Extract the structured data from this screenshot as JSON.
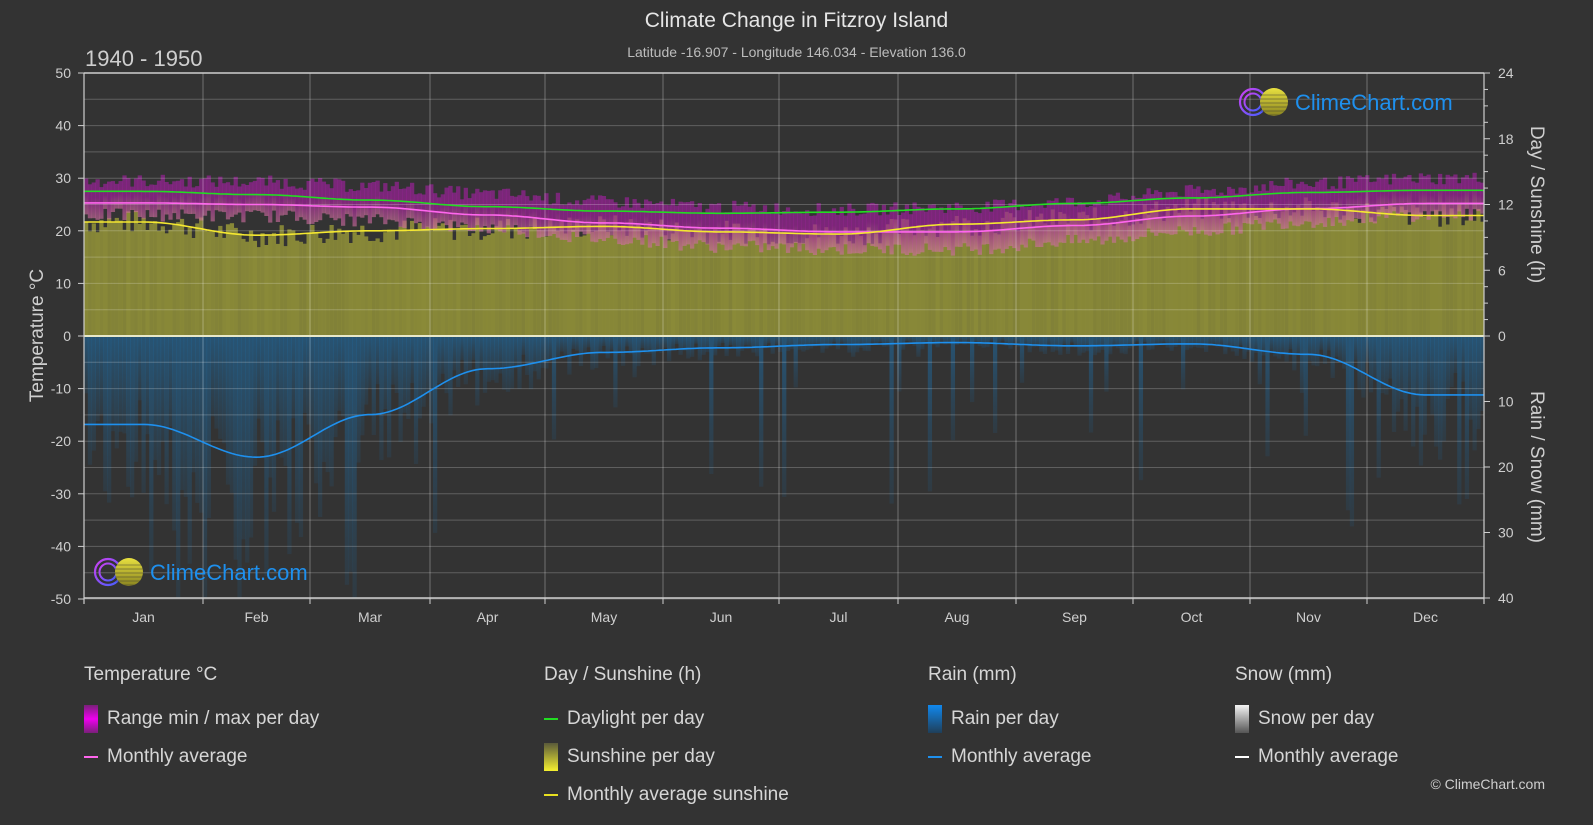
{
  "header": {
    "title": "Climate Change in Fitzroy Island",
    "subtitle": "Latitude -16.907 - Longitude 146.034 - Elevation 136.0",
    "year_range": "1940 - 1950"
  },
  "watermark": {
    "text": "ClimeChart.com"
  },
  "copyright": "© ClimeChart.com",
  "colors": {
    "background": "#333333",
    "temp_range": "#e000e0",
    "temp_avg": "#ff66ee",
    "daylight": "#22dd22",
    "sunshine_fill": "#8a8a38",
    "sunshine_avg": "#f5e830",
    "rain_fill": "#1f5e8c",
    "rain_avg": "#1e90ee",
    "snow_avg": "#ffffff",
    "brand_blue": "#1e90ee"
  },
  "chart_data": {
    "type": "area",
    "title": "Climate Change in Fitzroy Island",
    "subtitle": "Latitude -16.907 - Longitude 146.034 - Elevation 136.0",
    "period": "1940 - 1950",
    "categories": [
      "Jan",
      "Feb",
      "Mar",
      "Apr",
      "May",
      "Jun",
      "Jul",
      "Aug",
      "Sep",
      "Oct",
      "Nov",
      "Dec"
    ],
    "axes": {
      "left": {
        "label": "Temperature °C",
        "range": [
          -50,
          50
        ],
        "ticks": [
          50,
          40,
          30,
          20,
          10,
          0,
          -10,
          -20,
          -30,
          -40,
          -50
        ]
      },
      "right_top": {
        "label": "Day / Sunshine (h)",
        "range": [
          0,
          24
        ],
        "ticks": [
          24,
          18,
          12,
          6,
          0
        ]
      },
      "right_bottom": {
        "label": "Rain / Snow (mm)",
        "range": [
          0,
          40
        ],
        "ticks": [
          0,
          10,
          20,
          30,
          40
        ]
      }
    },
    "grid": true,
    "series": [
      {
        "name": "Daylight per day",
        "axis": "hours",
        "values": [
          13.2,
          12.9,
          12.4,
          11.8,
          11.4,
          11.2,
          11.3,
          11.6,
          12.1,
          12.6,
          13.1,
          13.3
        ]
      },
      {
        "name": "Monthly average sunshine",
        "axis": "hours",
        "values": [
          10.4,
          9.2,
          9.6,
          9.8,
          10.0,
          9.5,
          9.3,
          10.2,
          10.6,
          11.6,
          11.6,
          11.0
        ]
      },
      {
        "name": "Temperature monthly average",
        "axis": "temperature",
        "values": [
          25.3,
          25.0,
          24.5,
          23.0,
          21.5,
          20.5,
          19.8,
          19.8,
          21.0,
          22.8,
          24.2,
          25.2
        ]
      },
      {
        "name": "Temperature daily max (approx.)",
        "axis": "temperature",
        "values": [
          29.0,
          28.8,
          28.0,
          26.5,
          25.0,
          24.0,
          23.5,
          24.0,
          25.0,
          27.0,
          28.5,
          29.5
        ]
      },
      {
        "name": "Temperature daily min (approx.)",
        "axis": "temperature",
        "values": [
          23.0,
          22.8,
          22.0,
          20.5,
          18.5,
          17.0,
          16.5,
          16.5,
          18.0,
          20.0,
          21.8,
          23.0
        ]
      },
      {
        "name": "Rain monthly average",
        "axis": "rain_mm",
        "values": [
          13.5,
          18.5,
          12.0,
          5.0,
          2.5,
          1.8,
          1.3,
          1.0,
          1.5,
          1.2,
          2.8,
          9.0
        ]
      },
      {
        "name": "Snow monthly average",
        "axis": "rain_mm",
        "values": [
          0,
          0,
          0,
          0,
          0,
          0,
          0,
          0,
          0,
          0,
          0,
          0
        ]
      }
    ]
  },
  "legend": {
    "groups": [
      {
        "title": "Temperature °C",
        "items": [
          {
            "label": "Range min / max per day",
            "swatch": "bar-magenta"
          },
          {
            "label": "Monthly average",
            "swatch": "line-pink"
          }
        ]
      },
      {
        "title": "Day / Sunshine (h)",
        "items": [
          {
            "label": "Daylight per day",
            "swatch": "line-green"
          },
          {
            "label": "Sunshine per day",
            "swatch": "bar-yellow"
          },
          {
            "label": "Monthly average sunshine",
            "swatch": "line-yellow"
          }
        ]
      },
      {
        "title": "Rain (mm)",
        "items": [
          {
            "label": "Rain per day",
            "swatch": "bar-blue"
          },
          {
            "label": "Monthly average",
            "swatch": "line-blue"
          }
        ]
      },
      {
        "title": "Snow (mm)",
        "items": [
          {
            "label": "Snow per day",
            "swatch": "bar-white"
          },
          {
            "label": "Monthly average",
            "swatch": "line-white"
          }
        ]
      }
    ]
  }
}
